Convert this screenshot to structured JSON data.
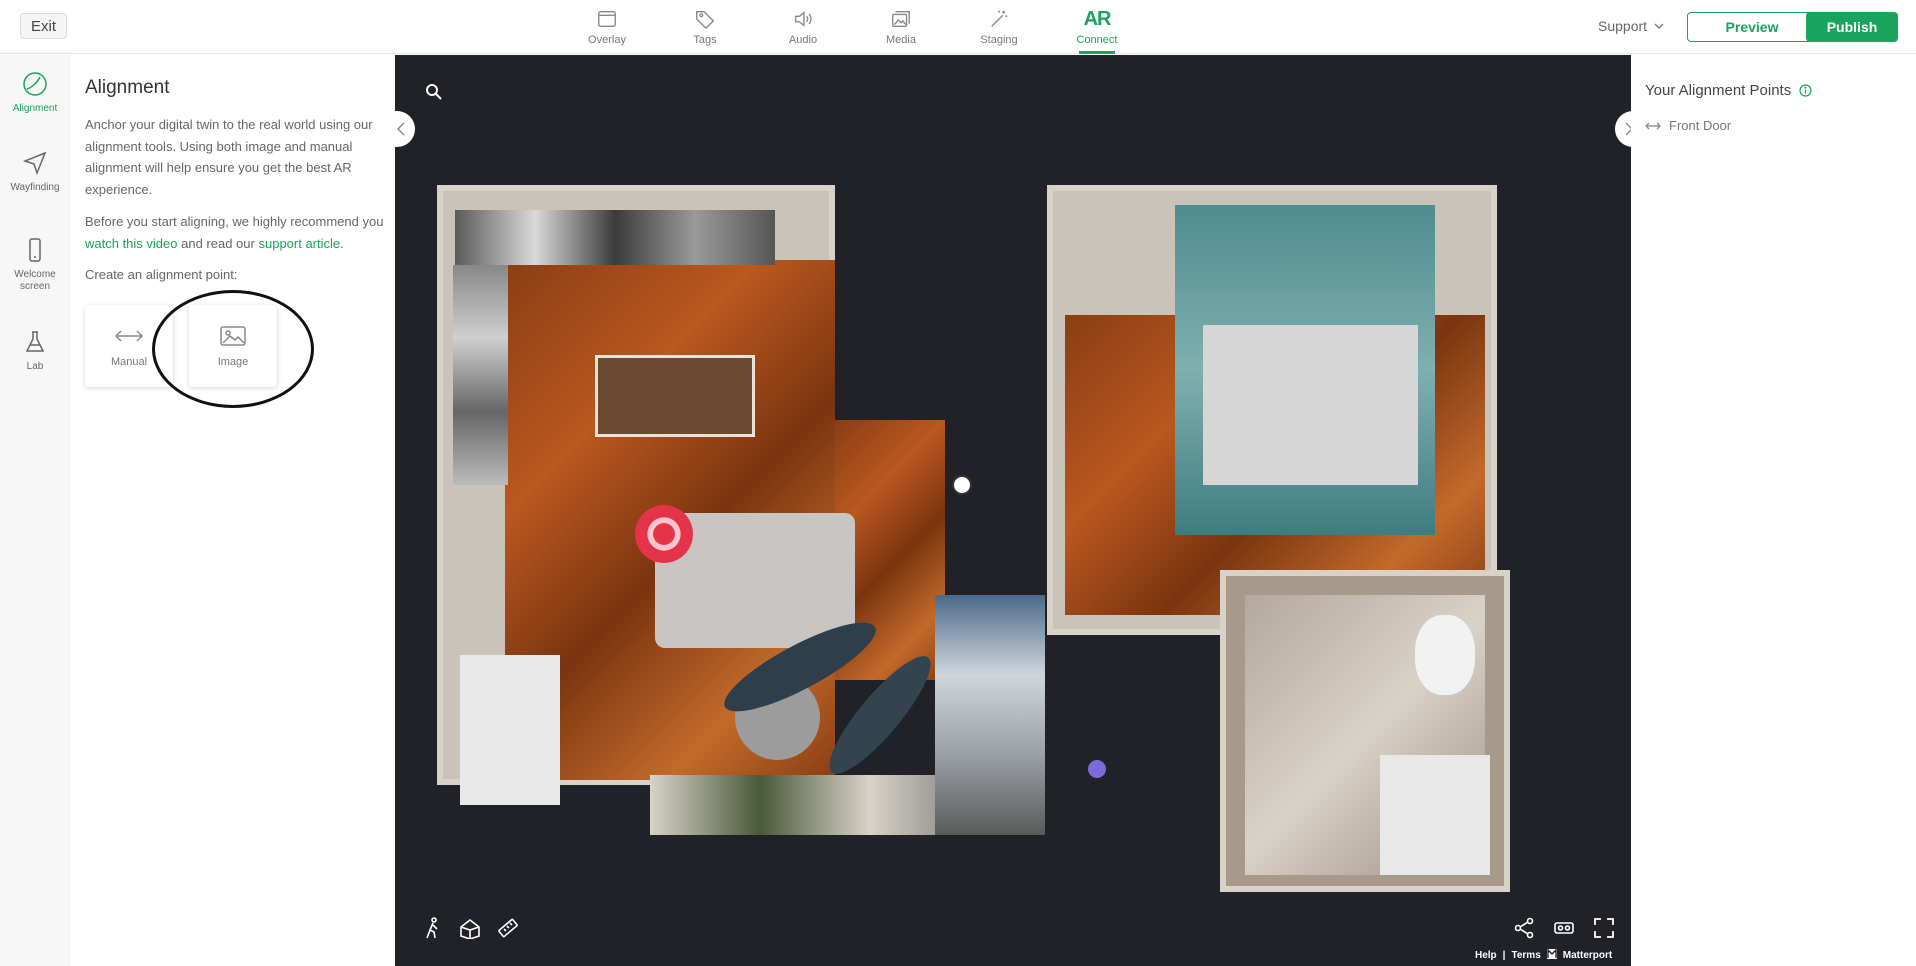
{
  "header": {
    "exit_label": "Exit",
    "tabs": [
      {
        "label": "Overlay",
        "icon": "overlay-icon",
        "active": false
      },
      {
        "label": "Tags",
        "icon": "tag-icon",
        "active": false
      },
      {
        "label": "Audio",
        "icon": "speaker-icon",
        "active": false
      },
      {
        "label": "Media",
        "icon": "media-icon",
        "active": false
      },
      {
        "label": "Staging",
        "icon": "magic-wand-icon",
        "active": false
      },
      {
        "label": "Connect",
        "icon": "ar-icon",
        "icon_text": "AR",
        "active": true
      }
    ],
    "support_label": "Support",
    "preview_label": "Preview",
    "publish_label": "Publish"
  },
  "rail": {
    "items": [
      {
        "label": "Alignment",
        "icon": "alignment-icon",
        "active": true
      },
      {
        "label": "Wayfinding",
        "icon": "navigation-arrow-icon",
        "active": false
      },
      {
        "label_line1": "Welcome",
        "label_line2": "screen",
        "icon": "phone-icon",
        "active": false
      },
      {
        "label": "Lab",
        "icon": "flask-icon",
        "active": false
      }
    ]
  },
  "panel": {
    "title": "Alignment",
    "intro": "Anchor your digital twin to the real world using our alignment tools. Using both image and manual alignment will help ensure you get the best AR experience.",
    "recommend_prefix": "Before you start aligning, we highly recommend you",
    "video_link": "watch this video",
    "recommend_middle": "and read our",
    "article_link": "support article",
    "recommend_suffix": ".",
    "create_label": "Create an alignment point:",
    "cards": [
      {
        "label": "Manual",
        "icon": "double-arrow-icon"
      },
      {
        "label": "Image",
        "icon": "image-icon"
      }
    ]
  },
  "viewer": {
    "footer_help": "Help",
    "footer_sep": "|",
    "footer_terms": "Terms",
    "footer_brand": "Matterport"
  },
  "right_panel": {
    "title": "Your Alignment Points",
    "points": [
      {
        "label": "Front Door",
        "icon": "double-arrow-icon"
      }
    ]
  },
  "colors": {
    "accent": "#1aa35c",
    "viewer_bg": "#202227"
  }
}
